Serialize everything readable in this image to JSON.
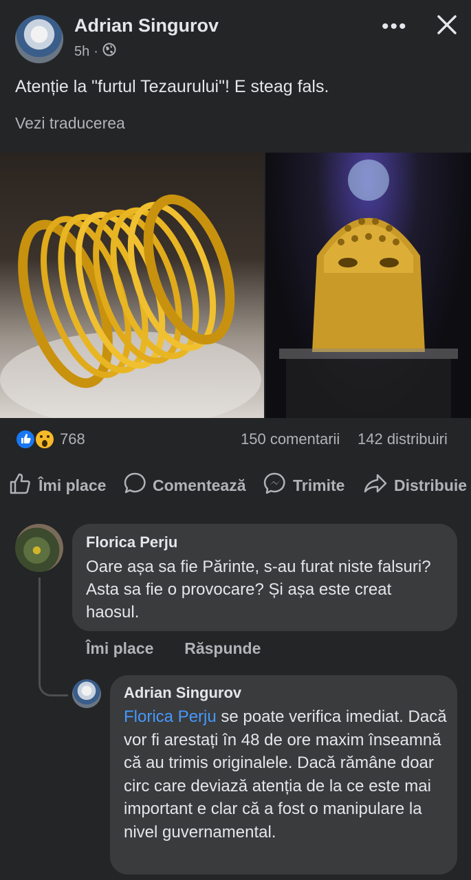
{
  "post": {
    "author": "Adrian Singurov",
    "time": "5h",
    "separator": "·",
    "text": "Atenție la \"furtul Tezaurului\"! E steag fals.",
    "see_translation": "Vezi traducerea"
  },
  "stats": {
    "reactions": "768",
    "comments": "150 comentarii",
    "shares": "142 distribuiri"
  },
  "actions": {
    "like": "Îmi place",
    "comment": "Comentează",
    "send": "Trimite",
    "share": "Distribuie"
  },
  "comments": [
    {
      "author": "Florica Perju",
      "text": "Oare așa sa fie Părinte, s-au furat niste falsuri? Asta sa fie o provocare? Și așa este creat haosul.",
      "like": "Îmi place",
      "reply": "Răspunde"
    },
    {
      "author": "Adrian Singurov",
      "mention": "Florica Perju",
      "text": " se poate verifica imediat. Dacă vor fi arestați în 48 de ore maxim înseamnă că au trimis originalele. Dacă rămâne doar circ care deviază atenția de la ce este mai important e clar că a fost o manipulare la nivel guvernamental."
    }
  ],
  "colors": {
    "background": "#242526",
    "bubble": "#3a3b3c",
    "mention": "#4599ff",
    "like_blue": "#1877f2",
    "wow_yellow": "#f7b928"
  }
}
